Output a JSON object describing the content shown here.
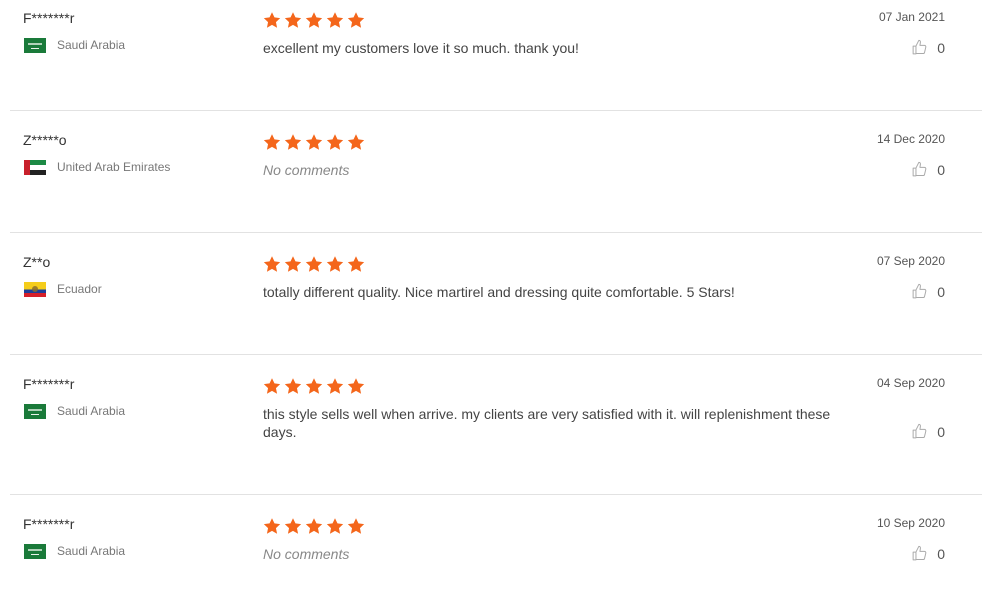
{
  "colors": {
    "star": "#f4661b",
    "divider": "#e2e2e2"
  },
  "reviews": [
    {
      "user": "F*******r",
      "country": "Saudi Arabia",
      "flag": "saudi-arabia-flag",
      "stars": 5,
      "comment": "excellent my customers love it so much. thank you!",
      "no_comment": false,
      "date": "07 Jan 2021",
      "likes": "0"
    },
    {
      "user": "Z*****o",
      "country": "United Arab Emirates",
      "flag": "uae-flag",
      "stars": 5,
      "comment": "No comments",
      "no_comment": true,
      "date": "14 Dec 2020",
      "likes": "0"
    },
    {
      "user": "Z**o",
      "country": "Ecuador",
      "flag": "ecuador-flag",
      "stars": 5,
      "comment": "totally different quality. Nice martirel and dressing quite comfortable. 5 Stars!",
      "no_comment": false,
      "date": "07 Sep 2020",
      "likes": "0"
    },
    {
      "user": "F*******r",
      "country": "Saudi Arabia",
      "flag": "saudi-arabia-flag",
      "stars": 5,
      "comment": "this style sells well when arrive. my clients are very satisfied with it. will replenishment these days.",
      "no_comment": false,
      "date": "04 Sep 2020",
      "likes": "0"
    },
    {
      "user": "F*******r",
      "country": "Saudi Arabia",
      "flag": "saudi-arabia-flag",
      "stars": 5,
      "comment": "No comments",
      "no_comment": true,
      "date": "10 Sep 2020",
      "likes": "0"
    }
  ]
}
